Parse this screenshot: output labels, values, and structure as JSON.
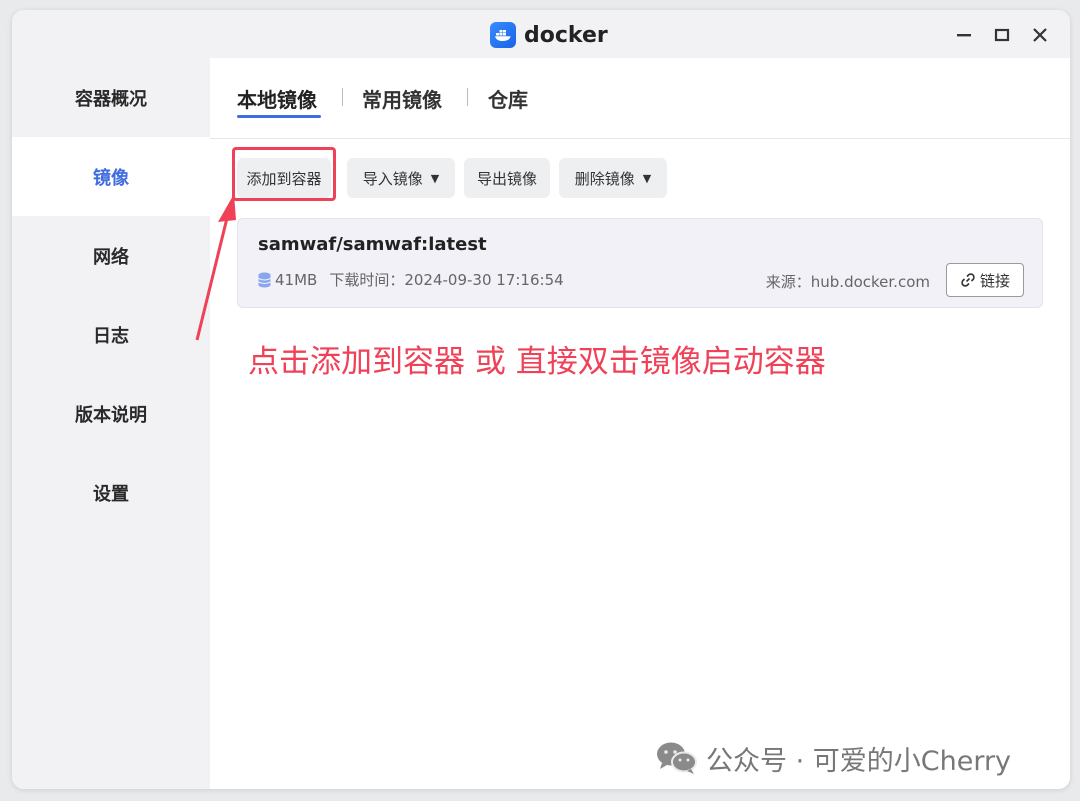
{
  "app": {
    "title": "docker",
    "logo_icon": "docker-whale-icon"
  },
  "window_controls": {
    "minimize_icon": "minimize-icon",
    "maximize_icon": "maximize-icon",
    "close_icon": "close-icon"
  },
  "sidebar": {
    "items": [
      {
        "label": "容器概况",
        "active": false
      },
      {
        "label": "镜像",
        "active": true
      },
      {
        "label": "网络",
        "active": false
      },
      {
        "label": "日志",
        "active": false
      },
      {
        "label": "版本说明",
        "active": false
      },
      {
        "label": "设置",
        "active": false
      }
    ]
  },
  "tabs": [
    {
      "label": "本地镜像",
      "active": true
    },
    {
      "label": "常用镜像",
      "active": false
    },
    {
      "label": "仓库",
      "active": false
    }
  ],
  "toolbar": {
    "add_to_container": "添加到容器",
    "import_image": "导入镜像",
    "export_image": "导出镜像",
    "delete_image": "删除镜像"
  },
  "image": {
    "name": "samwaf/samwaf:latest",
    "size": "41MB",
    "download_time_label": "下载时间：",
    "download_time": "2024-09-30 17:16:54",
    "source_label": "来源：",
    "source": "hub.docker.com",
    "link_label": "链接"
  },
  "annotation": {
    "text": "点击添加到容器 或 直接双击镜像启动容器"
  },
  "watermark": {
    "text": "公众号 · 可爱的小Cherry",
    "icon": "wechat-icon"
  },
  "colors": {
    "accent": "#3f6de0",
    "annotation_red": "#ef4157"
  }
}
